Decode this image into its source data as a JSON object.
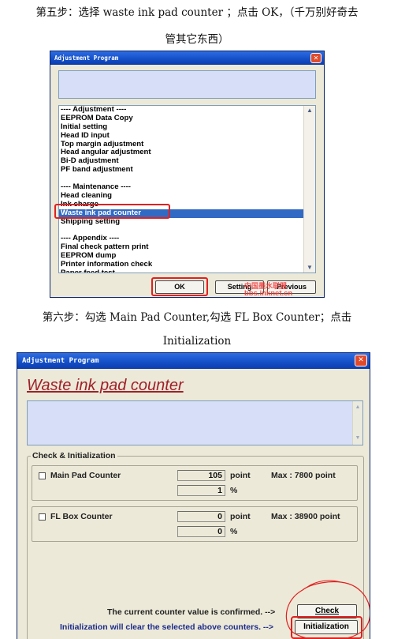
{
  "step5": {
    "line1": "第五步：选择 waste ink pad counter ；点击 OK，（千万别好奇去",
    "line2": "管其它东西）"
  },
  "step6": {
    "line1": "第六步：勾选 Main Pad Counter,勾选 FL Box Counter；点击",
    "line2": "Initialization"
  },
  "dialog1": {
    "title": "Adjustment Program",
    "close_glyph": "✕",
    "list_items": [
      "---- Adjustment ----",
      "EEPROM Data Copy",
      "Initial setting",
      "Head ID input",
      "Top margin adjustment",
      "Head angular adjustment",
      "Bi-D adjustment",
      "PF band adjustment",
      "",
      "---- Maintenance ----",
      "Head cleaning",
      "Ink charge",
      "Waste ink pad counter",
      "Shipping setting",
      "",
      "---- Appendix ----",
      "Final check pattern print",
      "EEPROM dump",
      "Printer information check",
      "Paper feed test"
    ],
    "selected_item": "Waste ink pad counter",
    "ok_label": "OK",
    "setting_label": "Setting",
    "previous_label": "Previous",
    "watermark_cn": "中国墨水联盟",
    "watermark_url": "bbs.inknet.cn"
  },
  "dialog2": {
    "title": "Adjustment Program",
    "close_glyph": "✕",
    "heading": "Waste ink pad counter",
    "group_label": "Check & Initialization",
    "main_pad": {
      "label": "Main Pad Counter",
      "checked": false,
      "value": "105",
      "unit": "point",
      "percent": "1",
      "percent_unit": "%",
      "max": "Max : 7800 point"
    },
    "fl_box": {
      "label": "FL Box Counter",
      "checked": false,
      "value": "0",
      "unit": "point",
      "percent": "0",
      "percent_unit": "%",
      "max": "Max : 38900 point"
    },
    "confirm_text": "The current counter value is confirmed. -->",
    "clear_text": "Initialization will clear the selected above counters. -->",
    "check_label": "Check",
    "init_label": "Initialization"
  },
  "colors": {
    "titlebar": "#1550c7",
    "selection": "#316ac5",
    "highlight_red": "#e02020",
    "heading_red": "#a0202a"
  }
}
